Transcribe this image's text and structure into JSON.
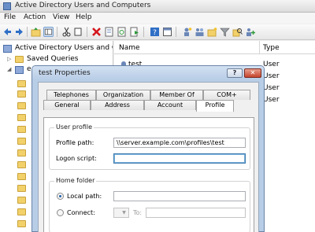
{
  "window": {
    "title": "Active Directory Users and Computers"
  },
  "menu": [
    "File",
    "Action",
    "View",
    "Help"
  ],
  "toolbar": {
    "buttons": [
      "back-icon",
      "forward-icon",
      "up-folder-icon",
      "show-hide-console-tree-icon",
      "cut-icon",
      "copy-icon",
      "delete-icon",
      "properties-icon",
      "refresh-icon",
      "export-list-icon",
      "help-icon",
      "console-icon",
      "new-user-icon",
      "new-group-icon",
      "new-ou-icon",
      "filter-icon",
      "find-icon",
      "add-to-group-icon"
    ]
  },
  "tree": {
    "root_label": "Active Directory Users and Com",
    "saved_queries_label": "Saved Queries",
    "domain_label": "e"
  },
  "list": {
    "col_name": "Name",
    "col_type": "Type",
    "rows": [
      {
        "name": "test",
        "type": "User"
      },
      {
        "name": "",
        "type": "User"
      },
      {
        "name": "",
        "type": "User"
      },
      {
        "name": "",
        "type": "User"
      }
    ]
  },
  "dialog": {
    "title": "test Properties",
    "help_button": "?",
    "close_button": "✕",
    "tabs_back_row": [
      "Telephones",
      "Organization",
      "Member Of",
      "COM+"
    ],
    "tabs_front_row": [
      "General",
      "Address",
      "Account",
      "Profile"
    ],
    "active_tab": "Profile",
    "user_profile": {
      "legend": "User profile",
      "profile_path_label": "Profile path:",
      "profile_path_value": "\\\\server.example.com\\profiles\\test",
      "logon_script_label": "Logon script:",
      "logon_script_value": ""
    },
    "home_folder": {
      "legend": "Home folder",
      "local_path_label": "Local path:",
      "local_path_value": "",
      "local_path_selected": true,
      "connect_label": "Connect:",
      "to_label": "To:",
      "to_value": ""
    }
  },
  "colors": {
    "dialog_frame": "#b8cde6",
    "close_button": "#c5432c",
    "folder": "#f2d16b"
  }
}
